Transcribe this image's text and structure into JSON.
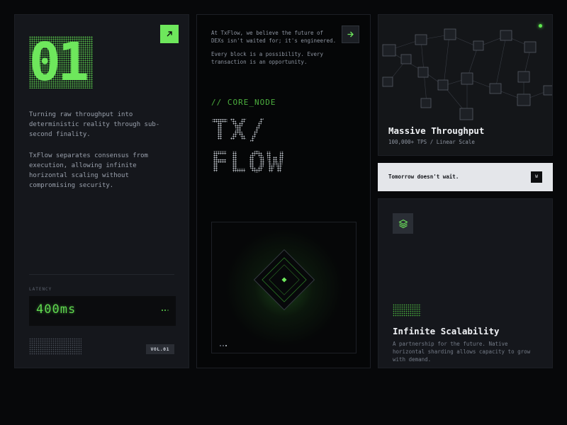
{
  "card_intro": {
    "number": "01",
    "paragraph_1": "Turning raw throughput into deterministic reality through sub-second finality.",
    "paragraph_2": "TxFlow separates consensus from execution, allowing infinite horizontal scaling without compromising security.",
    "latency_label": "LATENCY",
    "latency_value": "400ms",
    "volume_badge": "VOL.01",
    "icon": "arrow-up-right-icon"
  },
  "card_core": {
    "text_1": "At TxFlow, we believe the future of DEXs isn't waited for; it's engineered.",
    "text_2": "Every block is a possibility. Every transaction is an opportunity.",
    "core_label": "// CORE_NODE",
    "title_line_1": "TX/",
    "title_line_2": "FLOW",
    "icon": "arrow-right-icon"
  },
  "card_throughput": {
    "title": "Massive Throughput",
    "subtitle": "100,000+ TPS / Linear Scale",
    "status_color": "#5fe84f"
  },
  "card_tomorrow": {
    "text": "Tomorrow doesn't wait.",
    "button_label": "W"
  },
  "card_scalability": {
    "title": "Infinite Scalability",
    "description": "A partnership for the future. Native horizontal sharding allows capacity to grow with demand.",
    "icon": "layers-icon"
  },
  "colors": {
    "accent": "#6ee75c",
    "background": "#07080a",
    "card": "#15171c"
  }
}
